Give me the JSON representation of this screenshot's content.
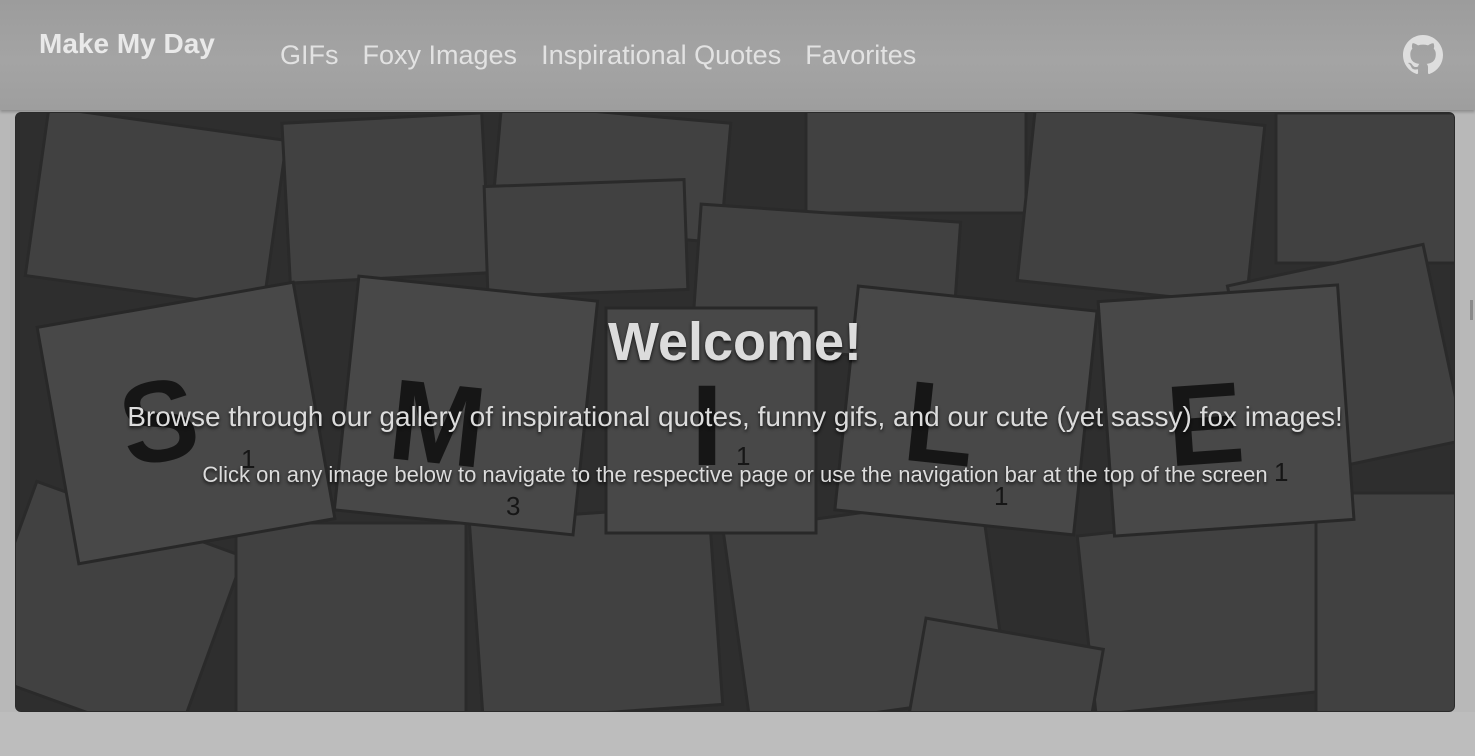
{
  "navbar": {
    "brand": "Make My Day",
    "links": [
      {
        "label": "GIFs"
      },
      {
        "label": "Foxy Images"
      },
      {
        "label": "Inspirational Quotes"
      },
      {
        "label": "Favorites"
      }
    ],
    "github_icon": "github-icon"
  },
  "hero": {
    "title": "Welcome!",
    "subtitle": "Browse through our gallery of inspirational quotes, funny gifs, and our cute (yet sassy) fox images!",
    "instruction": "Click on any image below to navigate to the respective page or use the navigation bar at the top of the screen",
    "background_tiles": [
      "S",
      "M",
      "I",
      "L",
      "E"
    ],
    "tile_subscripts": [
      "1",
      "3",
      "1",
      "1",
      "1"
    ]
  },
  "colors": {
    "navbar": "#a0a0a0",
    "hero_overlay": "#3a3a3a",
    "text_light": "#dcdcdc"
  }
}
